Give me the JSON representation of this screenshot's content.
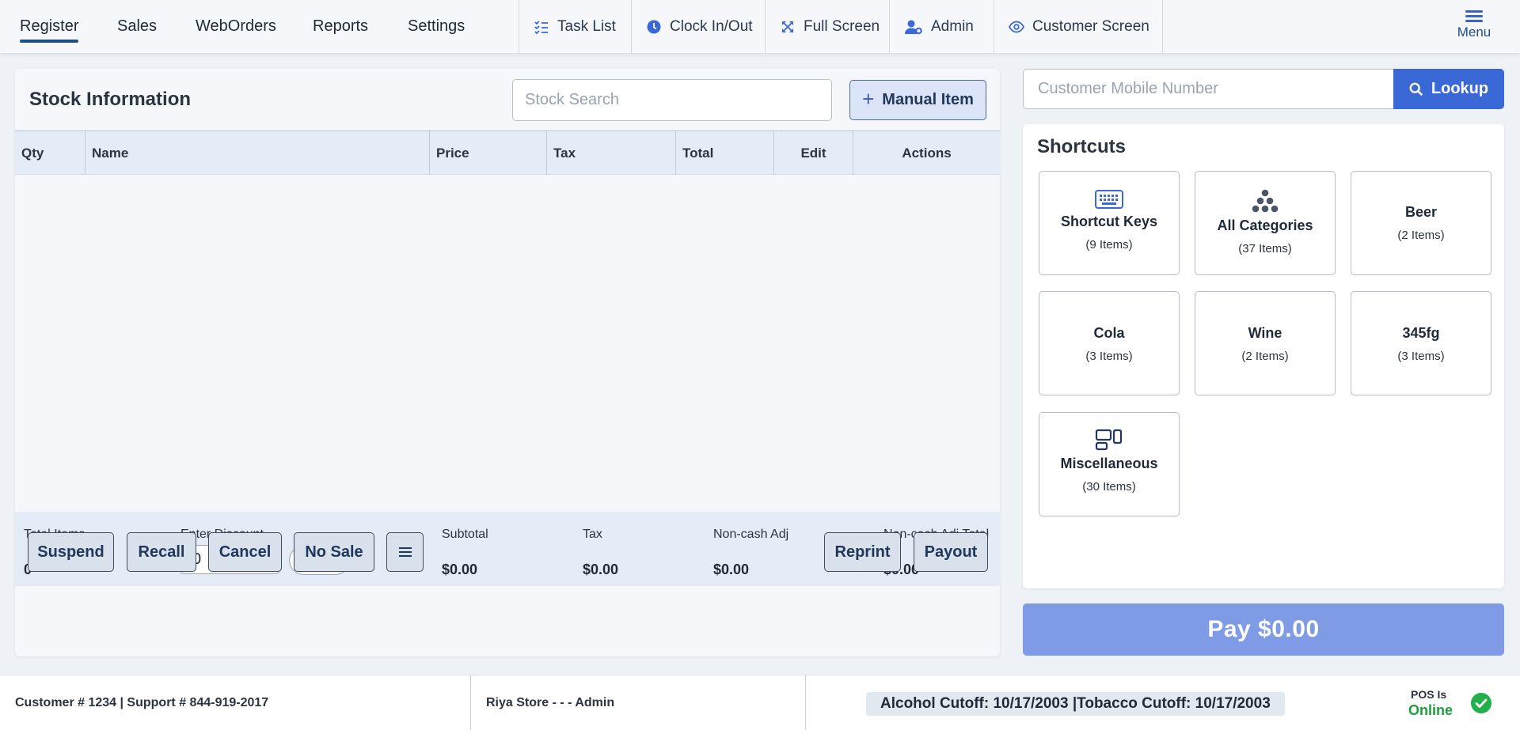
{
  "nav": {
    "tabs": [
      {
        "label": "Register",
        "active": true
      },
      {
        "label": "Sales"
      },
      {
        "label": "WebOrders"
      },
      {
        "label": "Reports"
      },
      {
        "label": "Settings"
      }
    ],
    "tools": [
      {
        "label": "Task List",
        "icon": "task-list-icon"
      },
      {
        "label": "Clock In/Out",
        "icon": "clock-icon"
      },
      {
        "label": "Full Screen",
        "icon": "fullscreen-icon"
      },
      {
        "label": "Admin",
        "icon": "admin-user-icon"
      },
      {
        "label": "Customer Screen",
        "icon": "eye-icon"
      }
    ],
    "menu_label": "Menu"
  },
  "stock": {
    "title": "Stock Information",
    "search_placeholder": "Stock Search",
    "manual_item_label": "Manual Item",
    "columns": [
      "Qty",
      "Name",
      "Price",
      "Tax",
      "Total",
      "Edit",
      "Actions"
    ]
  },
  "summary": {
    "total_items_label": "Total Items",
    "total_items_value": "0",
    "discount_label": "Enter Discount",
    "discount_value": "0",
    "toggle_percent": "%",
    "toggle_dollar": "$",
    "subtotal_label": "Subtotal",
    "subtotal_value": "$0.00",
    "tax_label": "Tax",
    "tax_value": "$0.00",
    "noncash_label": "Non-cash Adj",
    "noncash_value": "$0.00",
    "noncash_total_label": "Non-cash Adj Total",
    "noncash_total_value": "$0.00"
  },
  "actions": {
    "suspend": "Suspend",
    "recall": "Recall",
    "cancel": "Cancel",
    "no_sale": "No Sale",
    "reprint": "Reprint",
    "payout": "Payout"
  },
  "customer": {
    "mobile_placeholder": "Customer Mobile Number",
    "lookup_label": "Lookup"
  },
  "shortcuts": {
    "title": "Shortcuts",
    "tiles": [
      {
        "name": "Shortcut Keys",
        "count": "(9 Items)",
        "icon": "keyboard-icon"
      },
      {
        "name": "All Categories",
        "count": "(37 Items)",
        "icon": "categories-icon"
      },
      {
        "name": "Beer",
        "count": "(2 Items)"
      },
      {
        "name": "Cola",
        "count": "(3 Items)"
      },
      {
        "name": "Wine",
        "count": "(2 Items)"
      },
      {
        "name": "345fg",
        "count": "(3 Items)"
      },
      {
        "name": "Miscellaneous",
        "count": "(30 Items)",
        "icon": "miscellaneous-icon"
      }
    ]
  },
  "pay_label": "Pay $0.00",
  "footer": {
    "support": "Customer # 1234 | Support # 844-919-2017",
    "store": "Riya Store - - - Admin",
    "cutoff": "Alcohol Cutoff: 10/17/2003 |Tobacco Cutoff: 10/17/2003",
    "pos_label": "POS Is",
    "pos_status": "Online"
  },
  "colors": {
    "accent": "#3a68d6",
    "pay_button": "#7f9be6",
    "online": "#22b04a"
  }
}
